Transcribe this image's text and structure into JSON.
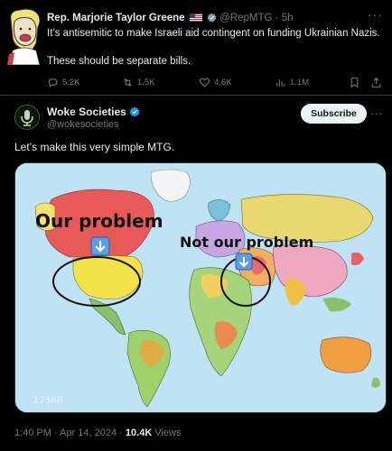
{
  "quoted": {
    "name": "Rep. Marjorie Taylor Greene",
    "handle": "@RepMTG",
    "time": "· 5h",
    "text_line1": "It’s antisemitic to make Israeli aid contingent on funding Ukrainian Nazis.",
    "text_line2": "These should be separate bills.",
    "actions": {
      "replies": "5.2K",
      "reposts": "1.5K",
      "likes": "4.6K",
      "views": "1.1M"
    }
  },
  "post": {
    "name": "Woke Societies",
    "handle": "@wokesocieties",
    "subscribe_label": "Subscribe",
    "text": "Let’s make this very simple MTG.",
    "map": {
      "label_left": "Our problem",
      "label_right": "Not our problem"
    },
    "footer": {
      "time": "1:40 PM · Apr 14, 2024 · ",
      "views_count": "10.4K",
      "views_label": " Views"
    }
  },
  "colors": {
    "background": "#000000",
    "text": "#e7e9ea",
    "muted": "#71767b",
    "verified": "#1d9bf0",
    "ocean": "#bfe3f5"
  }
}
